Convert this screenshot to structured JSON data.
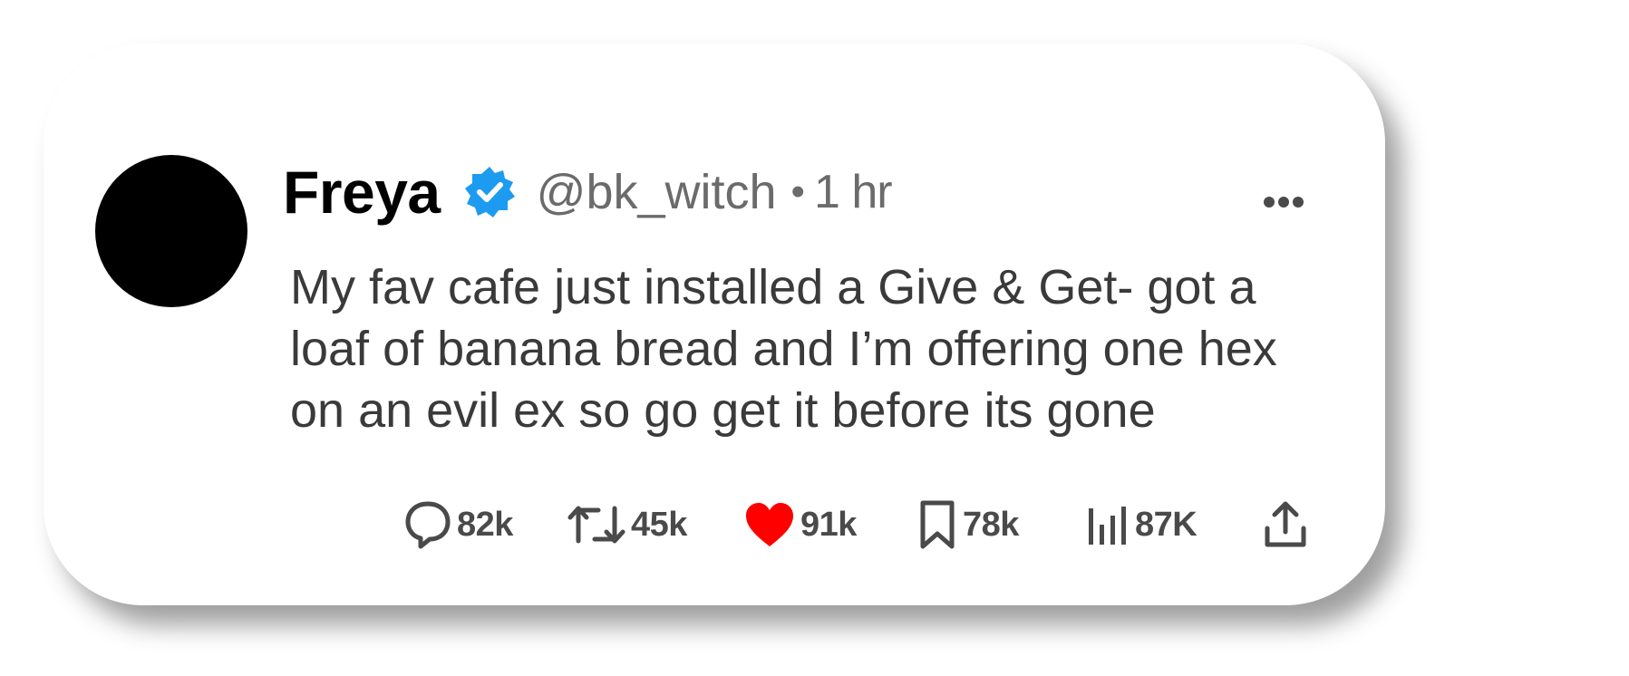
{
  "post": {
    "author_name": "Freya",
    "handle": "@bk_witch",
    "separator": "•",
    "time": "1 hr",
    "text": "My fav cafe just installed a Give & Get- got a loaf of banana bread and I’m offering one hex on an evil ex so go get it before its gone",
    "verified": true
  },
  "icons": {
    "verified": "verified-badge-icon",
    "more": "more-options-icon",
    "reply": "reply-icon",
    "repost": "repost-icon",
    "like": "heart-icon",
    "bookmark": "bookmark-icon",
    "views": "views-icon",
    "share": "share-icon"
  },
  "actions": {
    "replies": "82k",
    "reposts": "45k",
    "likes": "91k",
    "bookmarks": "78k",
    "views": "87K"
  },
  "colors": {
    "verified_blue": "#1d9bf0",
    "like_red": "#ff0000",
    "muted_text": "#6b6b6b",
    "avatar": "#000000"
  }
}
